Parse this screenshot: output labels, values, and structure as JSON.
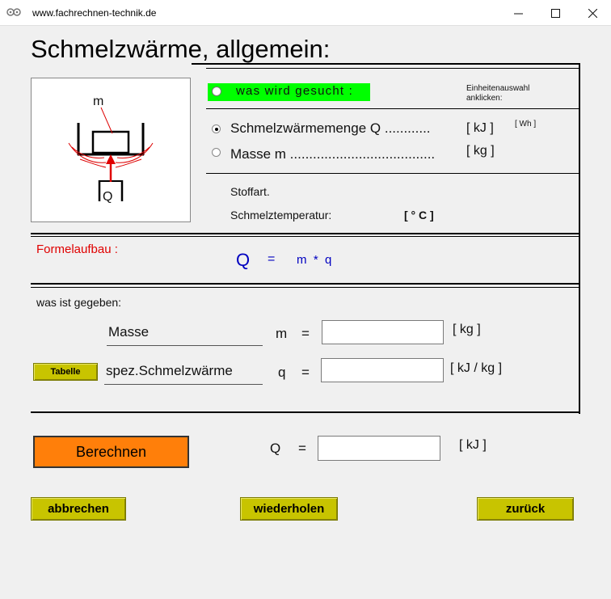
{
  "window": {
    "title": "www.fachrechnen-technik.de",
    "minimize": "—",
    "maximize": "☐",
    "close": "✕"
  },
  "page_title": "Schmelzwärme, allgemein:",
  "diagram": {
    "mass_label": "m",
    "heat_label": "Q"
  },
  "search": {
    "label": "was wird gesucht :",
    "unit_hint": "Einheitenauswahl anklicken:",
    "options": [
      {
        "label": "Schmelzwärmemenge  Q ............",
        "unit": "[ kJ ]",
        "alt_unit": "[ Wh ]",
        "selected": true
      },
      {
        "label": "Masse  m ......................................",
        "unit": "[ kg ]",
        "selected": false
      }
    ]
  },
  "material": {
    "substance_label": "Stoffart.",
    "melt_temp_label": "Schmelztemperatur:",
    "melt_temp_unit": "[ ° C ]"
  },
  "formula": {
    "label": "Formelaufbau :",
    "lhs": "Q",
    "eq": "=",
    "rhs": "m  *  q"
  },
  "given": {
    "label": "was ist gegeben:",
    "rows": [
      {
        "name": "Masse",
        "symbol": "m",
        "eq": "=",
        "value": "",
        "unit": "[ kg ]"
      },
      {
        "name": "spez.Schmelzwärme",
        "symbol": "q",
        "eq": "=",
        "value": "",
        "unit": "[ kJ / kg ]"
      }
    ],
    "table_button": "Tabelle"
  },
  "result": {
    "calc_button": "Berechnen",
    "symbol": "Q",
    "eq": "=",
    "value": "",
    "unit": "[ kJ ]"
  },
  "footer": {
    "cancel": "abbrechen",
    "repeat": "wiederholen",
    "back": "zurück"
  },
  "colors": {
    "green_highlight": "#00ff00",
    "olive_button": "#c8c400",
    "orange_button": "#ff7f0a",
    "formula_blue": "#0000c0",
    "label_red": "#e00000"
  }
}
